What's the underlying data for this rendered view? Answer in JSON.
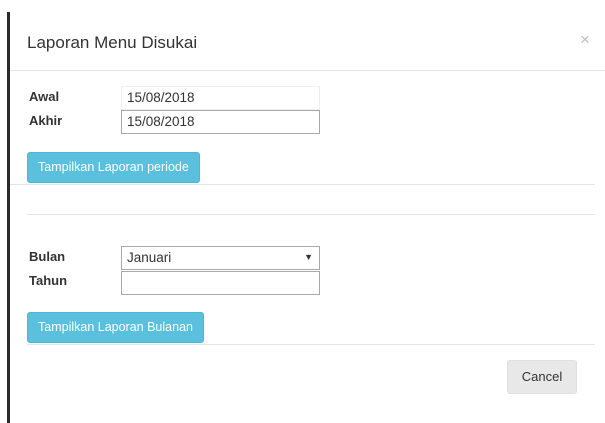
{
  "dialog": {
    "title": "Laporan Menu Disukai",
    "close_glyph": "×"
  },
  "period": {
    "start_label": "Awal",
    "start_value": "15/08/2018",
    "end_label": "Akhir",
    "end_value": "15/08/2018",
    "button_label": "Tampilkan Laporan periode"
  },
  "monthly": {
    "month_label": "Bulan",
    "month_value": "Januari",
    "month_arrow": "▼",
    "year_label": "Tahun",
    "year_value": "",
    "button_label": "Tampilkan Laporan Bulanan"
  },
  "footer": {
    "cancel_label": "Cancel"
  },
  "colors": {
    "info_button": "#5bc0de",
    "cancel_button": "#e8e8e8"
  }
}
